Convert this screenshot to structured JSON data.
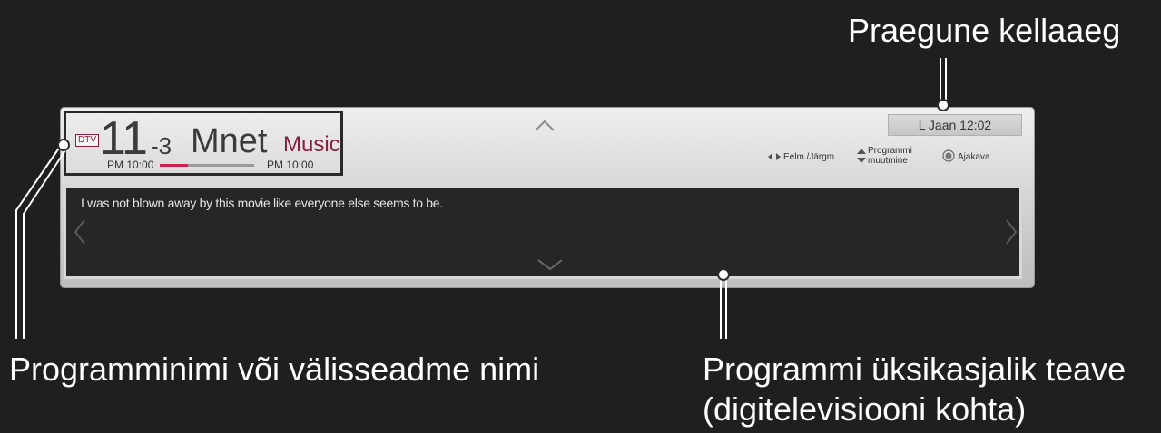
{
  "callouts": {
    "current_time": "Praegune kellaaeg",
    "program_name": "Programminimi või välisseadme nimi",
    "program_detail_line1": "Programmi üksikasjalik teave",
    "program_detail_line2": "(digitelevisiooni kohta)"
  },
  "channel": {
    "badge": "DTV",
    "number": "11",
    "sub_number": "-3",
    "name": "Mnet",
    "genre": "Music",
    "start_time": "PM 10:00",
    "end_time": "PM 10:00",
    "progress_fraction": 0.3
  },
  "clock": "L Jaan 12:02",
  "hints": {
    "prev_next": "Eelm./Järgm",
    "program_change_line1": "Programmi",
    "program_change_line2": "muutmine",
    "schedule": "Ajakava"
  },
  "detail_text": "I was not blown away by this movie like everyone else seems to be.",
  "icons": [
    "up-arrow-icon",
    "down-arrow-icon",
    "left-arrow-icon",
    "right-arrow-icon",
    "ok-button-icon"
  ],
  "colors": {
    "accent": "#8a1e3c",
    "progress": "#d02050",
    "background": "#1f1f1f"
  }
}
